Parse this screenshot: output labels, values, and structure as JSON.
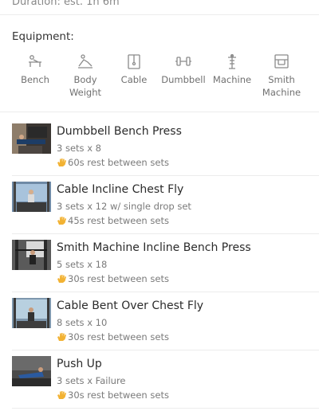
{
  "duration_text": "Duration: est. 1h 6m",
  "equipment": {
    "title": "Equipment:",
    "items": [
      {
        "label_line1": "Bench",
        "label_line2": "",
        "icon": "bench-icon"
      },
      {
        "label_line1": "Body",
        "label_line2": "Weight",
        "icon": "bodyweight-icon"
      },
      {
        "label_line1": "Cable",
        "label_line2": "",
        "icon": "cable-icon"
      },
      {
        "label_line1": "Dumbbell",
        "label_line2": "",
        "icon": "dumbbell-icon"
      },
      {
        "label_line1": "Machine",
        "label_line2": "",
        "icon": "machine-icon"
      },
      {
        "label_line1": "Smith",
        "label_line2": "Machine",
        "icon": "smith-machine-icon"
      }
    ]
  },
  "exercises": [
    {
      "name": "Dumbbell Bench Press",
      "sets": "3 sets x 8",
      "rest": "60s rest between sets"
    },
    {
      "name": "Cable Incline Chest Fly",
      "sets": "3 sets x 12 w/ single drop set",
      "rest": "45s rest between sets"
    },
    {
      "name": "Smith Machine Incline Bench Press",
      "sets": "5 sets x 18",
      "rest": "30s rest between sets"
    },
    {
      "name": "Cable Bent Over Chest Fly",
      "sets": "8 sets x 10",
      "rest": "30s rest between sets"
    },
    {
      "name": "Push Up",
      "sets": "3 sets x Failure",
      "rest": "30s rest between sets"
    }
  ],
  "colors": {
    "rest_hand": "#f2b233",
    "divider": "#ececec",
    "icon_gray": "#8a8a8a"
  }
}
